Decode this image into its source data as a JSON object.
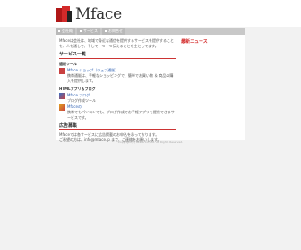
{
  "logo": {
    "text": "Mface"
  },
  "nav": {
    "items": [
      "会社概",
      "サービス",
      "お問合せ"
    ]
  },
  "intro": "Mfaceは会社は、地域で身近な通信を提供するサービスを提供することを、人を通して、そして一つ一つ伝えることを主としてます。",
  "services": {
    "title": "サービス一覧",
    "groups": [
      {
        "heading": "通販ツール",
        "items": [
          {
            "link": "Mface ショップ（ウェブ通販）",
            "desc": "携帯通販は、手軽なショッピングで、簡単でお買い物 ＆ 商品の購入を提供します。"
          }
        ]
      },
      {
        "heading": "HTMLアプリ＆ブログ",
        "items": [
          {
            "link": "Mface ブログ",
            "desc": "ブログ作成ツール"
          },
          {
            "link": "Mfaceの",
            "desc": "携帯でもパソコンでも、ブログ作成でお手軽アプリを提供できるサービスです。"
          }
        ]
      }
    ]
  },
  "ad": {
    "title": "広告募集",
    "text": "Mfaceでは各サービスに広告掲載のお申込を承っております。",
    "contact": "ご希望の方は、info@mface.jp まで、ご連絡をお願いします。"
  },
  "side": {
    "title": "最新ニュース"
  },
  "footer": "Copyright(C) Mface Co.,Ltd. All Rights Reserved."
}
